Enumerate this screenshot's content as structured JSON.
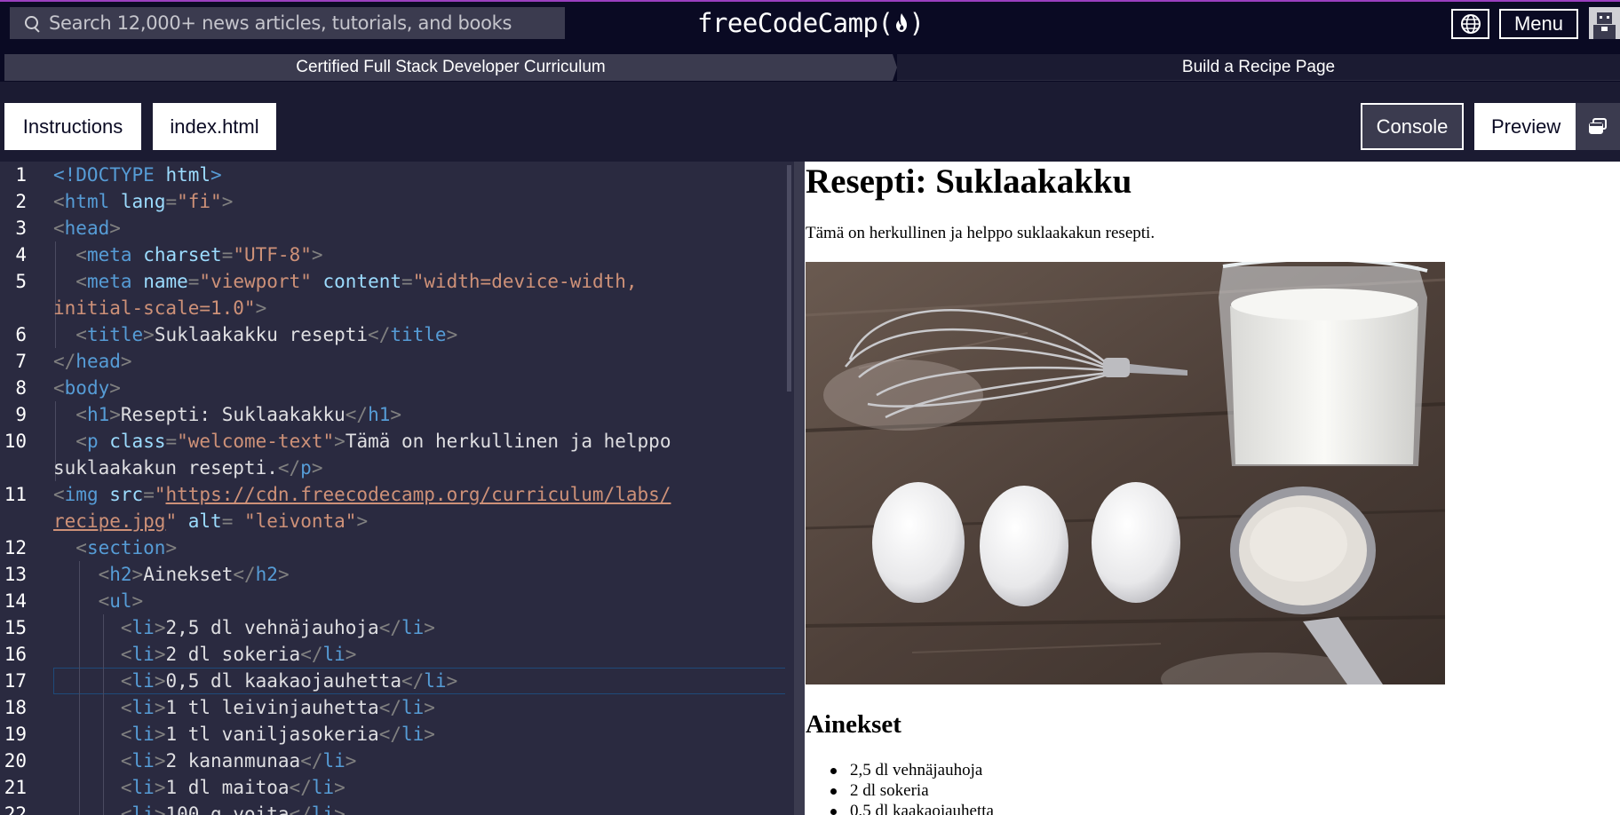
{
  "navbar": {
    "search_placeholder": "Search 12,000+ news articles, tutorials, and books",
    "logo_text": "freeCodeCamp(",
    "logo_close": ")",
    "menu_label": "Menu"
  },
  "breadcrumb": {
    "curriculum": "Certified Full Stack Developer Curriculum",
    "lesson": "Build a Recipe Page"
  },
  "tabs": {
    "instructions": "Instructions",
    "file": "index.html",
    "console": "Console",
    "preview": "Preview"
  },
  "editor": {
    "line_numbers": [
      "1",
      "2",
      "3",
      "4",
      "5",
      "",
      "6",
      "7",
      "8",
      "9",
      "10",
      "",
      "11",
      "",
      "12",
      "13",
      "14",
      "15",
      "16",
      "17",
      "18",
      "19",
      "20",
      "21",
      "22"
    ],
    "active_line": "17"
  },
  "preview": {
    "heading": "Resepti: Suklaakakku",
    "intro": "Tämä on herkullinen ja helppo suklaakakun resepti.",
    "image_alt": "leivonta",
    "section_heading": "Ainekset",
    "ingredients": [
      "2,5 dl vehnäjauhoja",
      "2 dl sokeria",
      "0,5 dl kaakaojauhetta"
    ]
  },
  "colors": {
    "bg_dark": "#0a0a23",
    "panel": "#1b1b32",
    "editor_bg": "#2a2a40",
    "tag": "#569cd6",
    "attr": "#9cdcfe",
    "string": "#ce9178"
  },
  "icons": [
    "search-icon",
    "fcc-flame-icon",
    "globe-icon",
    "avatar",
    "popout-icon"
  ]
}
